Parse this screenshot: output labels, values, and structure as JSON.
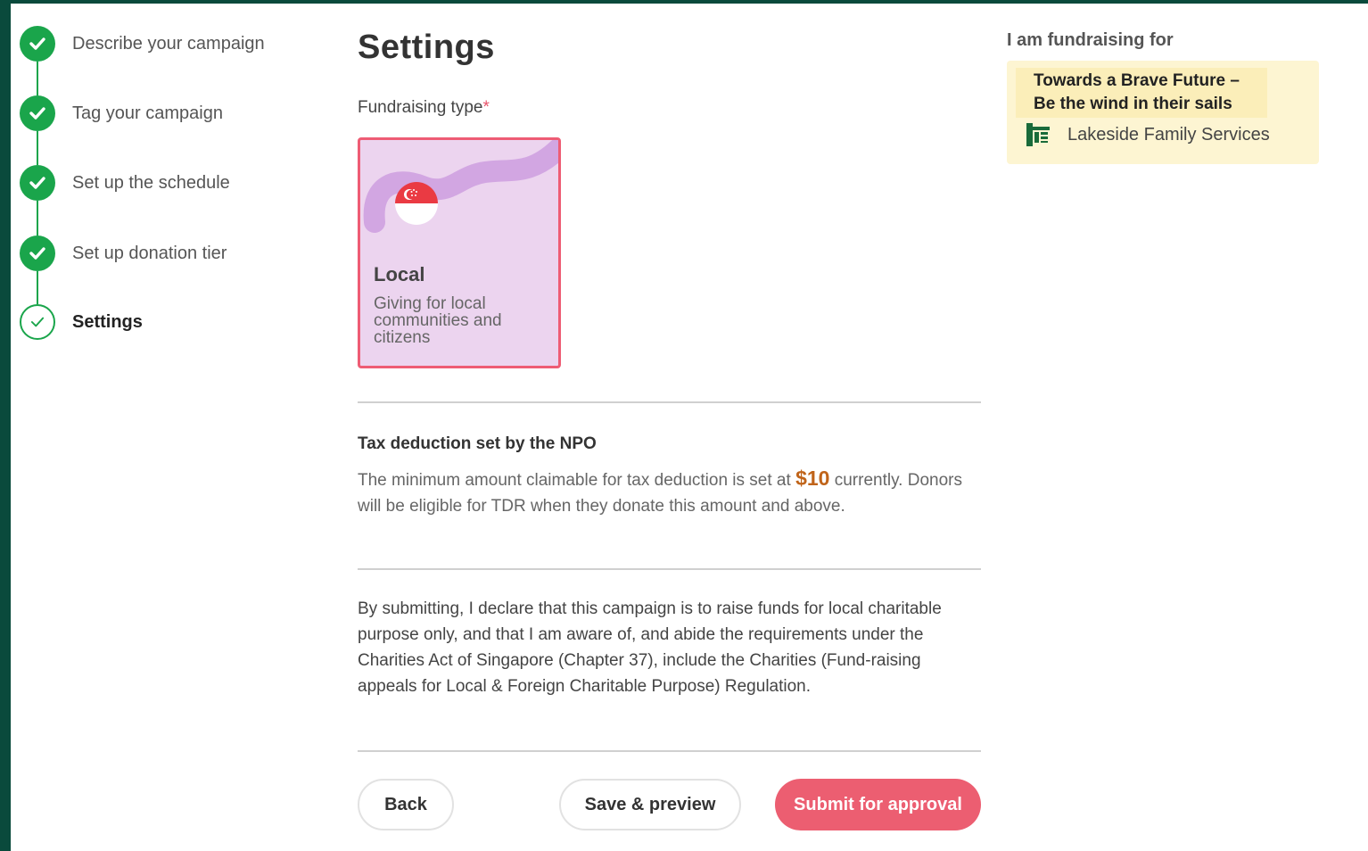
{
  "stepper": {
    "steps": [
      {
        "label": "Describe your campaign",
        "status": "complete"
      },
      {
        "label": "Tag your campaign",
        "status": "complete"
      },
      {
        "label": "Set up the schedule",
        "status": "complete"
      },
      {
        "label": "Set up donation tier",
        "status": "complete"
      },
      {
        "label": "Settings",
        "status": "current"
      }
    ]
  },
  "main": {
    "title": "Settings",
    "fundraising_type_label": "Fundraising type",
    "required_marker": "*",
    "type_card": {
      "title": "Local",
      "description": "Giving for local communities and citizens",
      "icon": "singapore-flag-icon"
    },
    "tax": {
      "title": "Tax deduction set by the NPO",
      "text_before": "The minimum amount claimable for tax deduction is set at ",
      "amount": "$10",
      "text_after": " currently. Donors will be eligible for TDR when they donate this amount and above."
    },
    "declaration": "By submitting, I declare that this campaign is to raise funds for local charitable purpose only, and that I am aware of, and abide the requirements under the Charities Act of Singapore (Chapter 37), include the Charities (Fund-raising appeals for Local & Foreign Charitable Purpose) Regulation.",
    "buttons": {
      "back": "Back",
      "save_preview": "Save & preview",
      "submit": "Submit for approval"
    }
  },
  "side": {
    "heading": "I am fundraising for",
    "campaign_line1": "Towards a Brave Future –",
    "campaign_line2": "Be the wind in their sails",
    "org_name": "Lakeside Family Services",
    "org_logo": "org-logo-icon"
  },
  "colors": {
    "accent": "#ec5e71",
    "step_complete": "#1aa54b",
    "card_bg": "#ecd4ef",
    "side_card_bg": "#fdf5d2",
    "frame": "#0a4a3c"
  }
}
